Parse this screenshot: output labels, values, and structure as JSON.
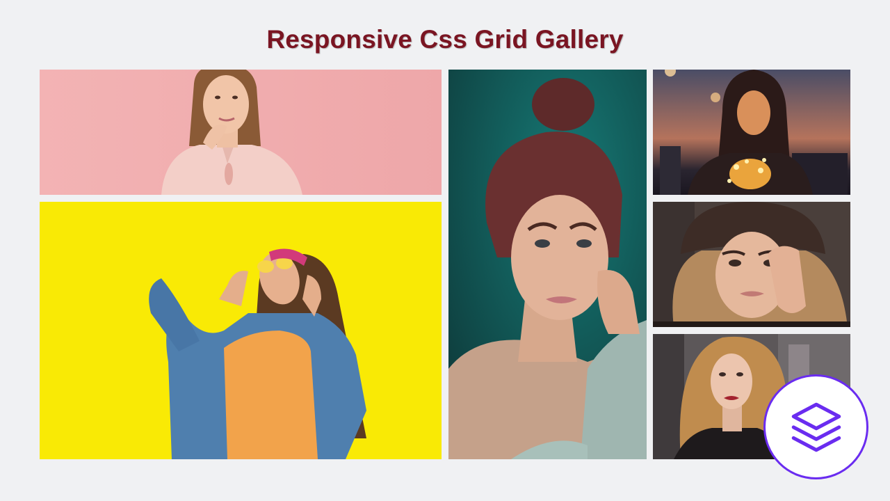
{
  "page": {
    "title": "Responsive Css Grid Gallery"
  },
  "gallery": {
    "items": [
      {
        "subject": "woman in pink blouse on pink background",
        "background": "#f2aeb0"
      },
      {
        "subject": "woman in denim jacket and sunglasses on yellow wall",
        "background": "#f8e806"
      },
      {
        "subject": "woman with red hair bun on teal background",
        "background": "#1e5f5b"
      },
      {
        "subject": "woman holding string lights at dusk",
        "background": "#3a3445"
      },
      {
        "subject": "woman in fur hat with hand on face",
        "background": "#4a3f3a"
      },
      {
        "subject": "woman with curly blonde hair on street",
        "background": "#5a5658"
      }
    ]
  },
  "logo": {
    "icon": "layers-icon",
    "color": "#6a2cf0"
  },
  "colors": {
    "page_background": "#f0f1f3",
    "title": "#7a1522",
    "accent": "#6a2cf0"
  }
}
